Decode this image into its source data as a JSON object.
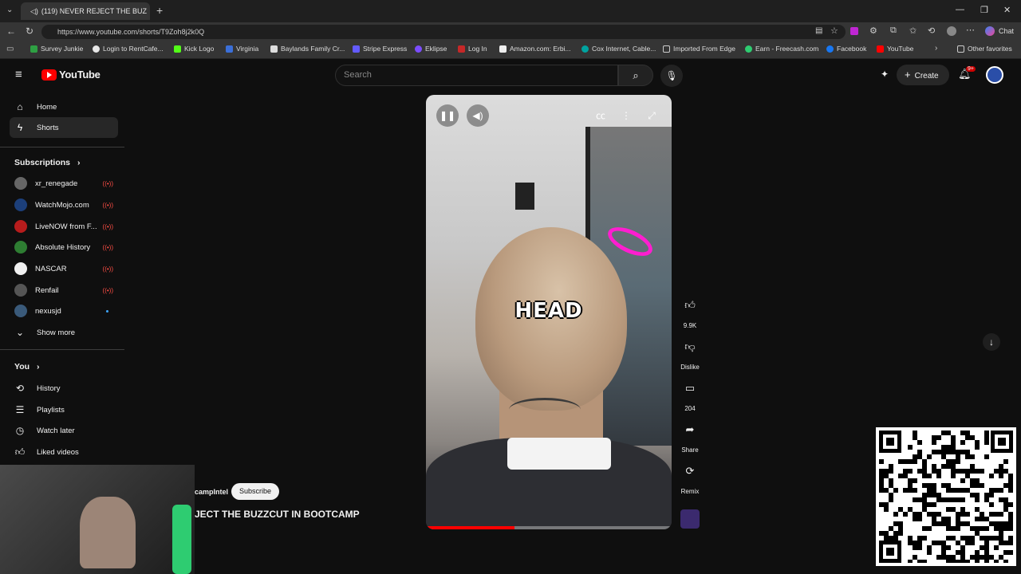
{
  "browser": {
    "tab_title": "(119) NEVER REJECT THE BUZ",
    "url": "https://www.youtube.com/shorts/T9Zoh8j2k0Q",
    "bookmarks": [
      "Survey Junkie",
      "Login to RentCafe...",
      "Kick Logo",
      "Virginia",
      "Baylands Family Cr...",
      "Stripe Express",
      "Eklipse",
      "Log In",
      "Amazon.com: Erbi...",
      "Cox Internet, Cable...",
      "Imported From Edge",
      "Earn - Freecash.com",
      "Facebook",
      "YouTube",
      "Other favorites"
    ],
    "chat_label": "Chat"
  },
  "header": {
    "logo_text": "YouTube",
    "search_placeholder": "Search",
    "create_label": "Create",
    "notification_badge": "9+"
  },
  "sidebar": {
    "home": "Home",
    "shorts": "Shorts",
    "subscriptions_label": "Subscriptions",
    "subscriptions": [
      {
        "name": "xr_renegade",
        "color": "#666666"
      },
      {
        "name": "WatchMojo.com",
        "color": "#1c3f7a"
      },
      {
        "name": "LiveNOW from F...",
        "color": "#b71c1c"
      },
      {
        "name": "Absolute History",
        "color": "#2e7d32"
      },
      {
        "name": "NASCAR",
        "color": "#f0f0f0"
      },
      {
        "name": "Renfail",
        "color": "#555555"
      },
      {
        "name": "nexusjd",
        "color": "#3a5a7a"
      }
    ],
    "show_more": "Show more",
    "you_label": "You",
    "history": "History",
    "playlists": "Playlists",
    "watch_later": "Watch later",
    "liked_videos": "Liked videos"
  },
  "short": {
    "caption": "HEAD",
    "channel_partial": "campIntel",
    "subscribe_label": "Subscribe",
    "title_partial": "JECT THE BUZZCUT IN BOOTCAMP",
    "progress": 0.36
  },
  "actions": {
    "likes": "9.9K",
    "dislike": "Dislike",
    "comments": "204",
    "share": "Share",
    "remix": "Remix"
  }
}
